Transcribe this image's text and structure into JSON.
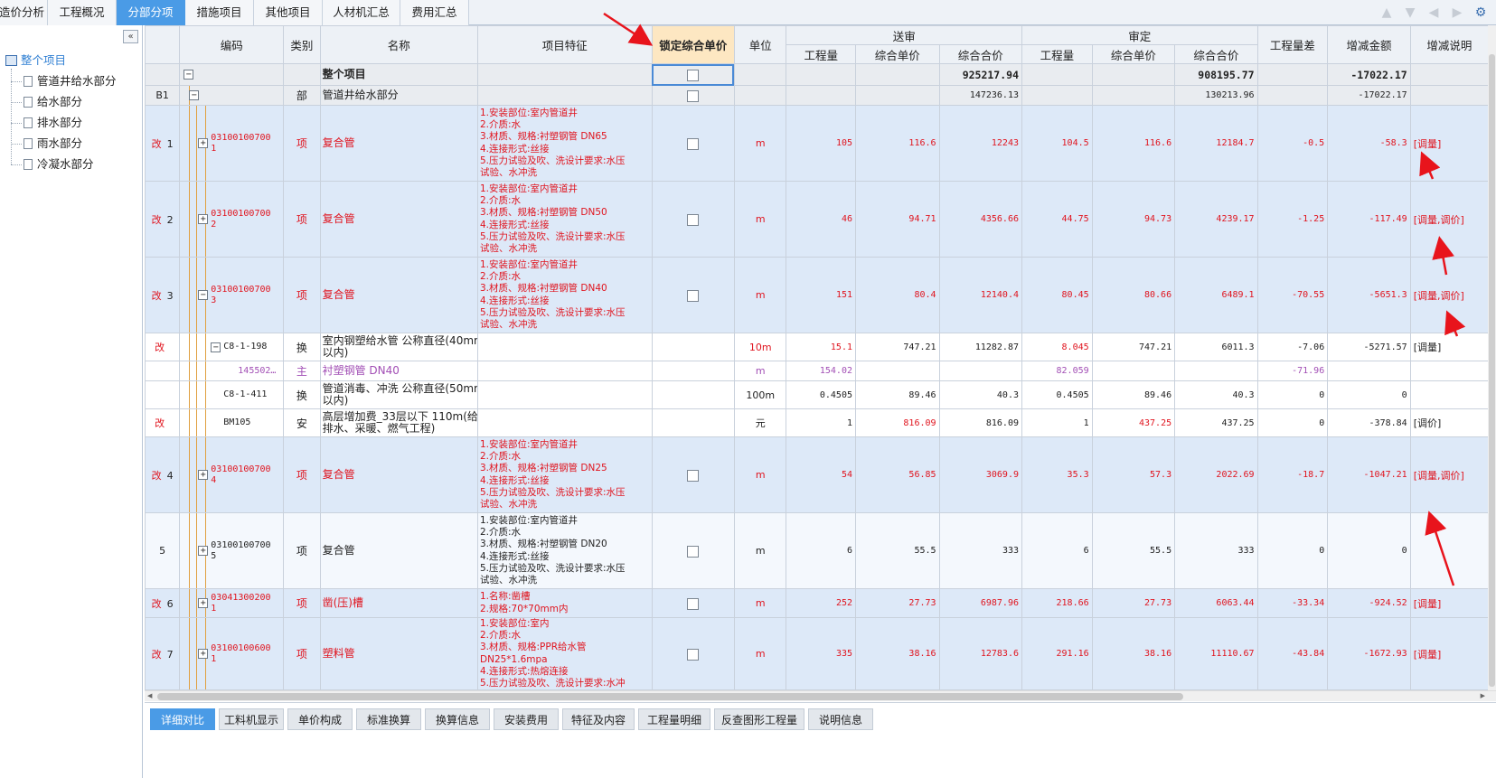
{
  "top_tabs": [
    "造价分析",
    "工程概况",
    "分部分项",
    "措施项目",
    "其他项目",
    "人材机汇总",
    "费用汇总"
  ],
  "top_active": "分部分项",
  "tree": {
    "root": "整个项目",
    "children": [
      "管道井给水部分",
      "给水部分",
      "排水部分",
      "雨水部分",
      "冷凝水部分"
    ]
  },
  "headers": {
    "code": "编码",
    "type": "类别",
    "name": "名称",
    "feature": "项目特征",
    "lock": "锁定综合单价",
    "unit": "单位",
    "sent": "送审",
    "approved": "审定",
    "qty": "工程量",
    "uprice": "综合单价",
    "total": "综合合价",
    "qtydiff": "工程量差",
    "amtdiff": "增减金额",
    "note": "增减说明"
  },
  "rows": [
    {
      "kind": "total",
      "name": "整个项目",
      "s_total": "925217.94",
      "a_total": "908195.77",
      "amt_diff": "-17022.17"
    },
    {
      "kind": "part",
      "idx": "B1",
      "type": "部",
      "name": "管道井给水部分",
      "s_total": "147236.13",
      "a_total": "130213.96",
      "amt_diff": "-17022.17"
    },
    {
      "kind": "item",
      "mark": "改",
      "idx": "1",
      "code": "03100100700\n1",
      "type": "项",
      "name": "复合管",
      "feature": "1.安装部位:室内管道井\n2.介质:水\n3.材质、规格:衬塑钢管 DN65\n4.连接形式:丝接\n5.压力试验及吹、洗设计要求:水压\n试验、水冲洗",
      "unit": "m",
      "s_qty": "105",
      "s_price": "116.6",
      "s_total": "12243",
      "a_qty": "104.5",
      "a_price": "116.6",
      "a_total": "12184.7",
      "qty_diff": "-0.5",
      "amt_diff": "-58.3",
      "note": "[调量]",
      "red": true,
      "pm": "+"
    },
    {
      "kind": "item",
      "mark": "改",
      "idx": "2",
      "code": "03100100700\n2",
      "type": "项",
      "name": "复合管",
      "feature": "1.安装部位:室内管道井\n2.介质:水\n3.材质、规格:衬塑钢管 DN50\n4.连接形式:丝接\n5.压力试验及吹、洗设计要求:水压\n试验、水冲洗",
      "unit": "m",
      "s_qty": "46",
      "s_price": "94.71",
      "s_total": "4356.66",
      "a_qty": "44.75",
      "a_price": "94.73",
      "a_total": "4239.17",
      "qty_diff": "-1.25",
      "amt_diff": "-117.49",
      "note": "[调量,调价]",
      "red": true,
      "pm": "+"
    },
    {
      "kind": "item",
      "mark": "改",
      "idx": "3",
      "code": "03100100700\n3",
      "type": "项",
      "name": "复合管",
      "feature": "1.安装部位:室内管道井\n2.介质:水\n3.材质、规格:衬塑钢管 DN40\n4.连接形式:丝接\n5.压力试验及吹、洗设计要求:水压\n试验、水冲洗",
      "unit": "m",
      "s_qty": "151",
      "s_price": "80.4",
      "s_total": "12140.4",
      "a_qty": "80.45",
      "a_price": "80.66",
      "a_total": "6489.1",
      "qty_diff": "-70.55",
      "amt_diff": "-5651.3",
      "note": "[调量,调价]",
      "red": true,
      "pm": "−"
    },
    {
      "kind": "sub",
      "mark": "改",
      "code": "C8-1-198",
      "type": "换",
      "name": "室内钢塑给水管 公称直径(40mm\n以内)",
      "unit": "10m",
      "s_qty": "15.1",
      "s_price": "747.21",
      "s_total": "11282.87",
      "a_qty": "8.045",
      "a_price": "747.21",
      "a_total": "6011.3",
      "qty_diff": "-7.06",
      "amt_diff": "-5271.57",
      "note": "[调量]",
      "redqty": true,
      "pm": "−"
    },
    {
      "kind": "main",
      "code": "145502…",
      "type": "主",
      "name": "衬塑钢管 DN40",
      "unit": "m",
      "s_qty": "154.02",
      "a_qty": "82.059",
      "qty_diff": "-71.96"
    },
    {
      "kind": "sub",
      "mark": "",
      "code": "C8-1-411",
      "type": "换",
      "name": "管道消毒、冲洗 公称直径(50mm\n以内)",
      "unit": "100m",
      "s_qty": "0.4505",
      "s_price": "89.46",
      "s_total": "40.3",
      "a_qty": "0.4505",
      "a_price": "89.46",
      "a_total": "40.3",
      "qty_diff": "0",
      "amt_diff": "0",
      "note": ""
    },
    {
      "kind": "sub",
      "mark": "改",
      "code": "BM105",
      "type": "安",
      "name": "高层增加费_33层以下 110m(给\n排水、采暖、燃气工程)",
      "unit": "元",
      "s_qty": "1",
      "s_price": "816.09",
      "s_total": "816.09",
      "a_qty": "1",
      "a_price": "437.25",
      "a_total": "437.25",
      "qty_diff": "0",
      "amt_diff": "-378.84",
      "note": "[调价]",
      "redprice": true
    },
    {
      "kind": "item",
      "mark": "改",
      "idx": "4",
      "code": "03100100700\n4",
      "type": "项",
      "name": "复合管",
      "feature": "1.安装部位:室内管道井\n2.介质:水\n3.材质、规格:衬塑钢管 DN25\n4.连接形式:丝接\n5.压力试验及吹、洗设计要求:水压\n试验、水冲洗",
      "unit": "m",
      "s_qty": "54",
      "s_price": "56.85",
      "s_total": "3069.9",
      "a_qty": "35.3",
      "a_price": "57.3",
      "a_total": "2022.69",
      "qty_diff": "-18.7",
      "amt_diff": "-1047.21",
      "note": "[调量,调价]",
      "red": true,
      "pm": "+"
    },
    {
      "kind": "item",
      "mark": "",
      "idx": "5",
      "code": "03100100700\n5",
      "type": "项",
      "name": "复合管",
      "feature": "1.安装部位:室内管道井\n2.介质:水\n3.材质、规格:衬塑钢管 DN20\n4.连接形式:丝接\n5.压力试验及吹、洗设计要求:水压\n试验、水冲洗",
      "unit": "m",
      "s_qty": "6",
      "s_price": "55.5",
      "s_total": "333",
      "a_qty": "6",
      "a_price": "55.5",
      "a_total": "333",
      "qty_diff": "0",
      "amt_diff": "0",
      "note": "",
      "red": false,
      "pm": "+"
    },
    {
      "kind": "item",
      "mark": "改",
      "idx": "6",
      "code": "03041300200\n1",
      "type": "项",
      "name": "凿(压)槽",
      "feature": "1.名称:凿槽\n2.规格:70*70mm内",
      "unit": "m",
      "s_qty": "252",
      "s_price": "27.73",
      "s_total": "6987.96",
      "a_qty": "218.66",
      "a_price": "27.73",
      "a_total": "6063.44",
      "qty_diff": "-33.34",
      "amt_diff": "-924.52",
      "note": "[调量]",
      "red": true,
      "pm": "+"
    },
    {
      "kind": "item",
      "mark": "改",
      "idx": "7",
      "code": "03100100600\n1",
      "type": "项",
      "name": "塑料管",
      "feature": "1.安装部位:室内\n2.介质:水\n3.材质、规格:PPR给水管\nDN25*1.6mpa\n4.连接形式:热熔连接\n5.压力试验及吹、洗设计要求:水冲",
      "unit": "m",
      "s_qty": "335",
      "s_price": "38.16",
      "s_total": "12783.6",
      "a_qty": "291.16",
      "a_price": "38.16",
      "a_total": "11110.67",
      "qty_diff": "-43.84",
      "amt_diff": "-1672.93",
      "note": "[调量]",
      "red": true,
      "pm": "+"
    }
  ],
  "bottom_tabs": [
    "详细对比",
    "工料机显示",
    "单价构成",
    "标准换算",
    "换算信息",
    "安装费用",
    "特征及内容",
    "工程量明细",
    "反查图形工程量",
    "说明信息"
  ],
  "bottom_active": "详细对比",
  "colors": {
    "accent": "#4a9be6",
    "change": "#e0141e",
    "material": "#a24fb5",
    "lock_header": "#fde7c2"
  }
}
